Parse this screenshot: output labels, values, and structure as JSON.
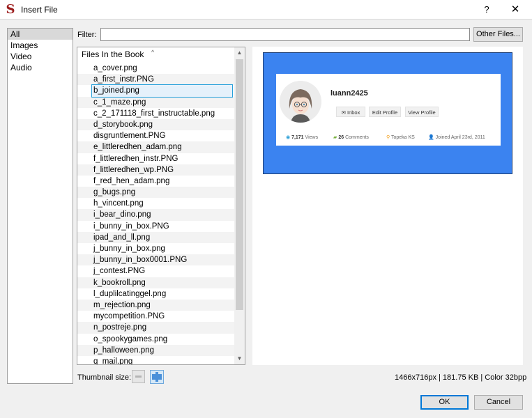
{
  "window": {
    "title": "Insert File",
    "help_label": "?",
    "close_label": "✕",
    "logo_letter": "S",
    "logo_color": "#9b1c1c"
  },
  "categories": {
    "selected_index": 0,
    "items": [
      "All",
      "Images",
      "Video",
      "Audio"
    ]
  },
  "filter": {
    "label": "Filter:",
    "value": "",
    "other_files_label": "Other Files..."
  },
  "file_list": {
    "header": "Files In the Book",
    "sort_indicator": "^",
    "selected_index": 2,
    "files": [
      "a_cover.png",
      "a_first_instr.PNG",
      "b_joined.png",
      "c_1_maze.png",
      "c_2_171118_first_instructable.png",
      "d_storybook.png",
      "disgruntlement.PNG",
      "e_littleredhen_adam.png",
      "f_littleredhen_instr.PNG",
      "f_littleredhen_wp.PNG",
      "f_red_hen_adam.png",
      "g_bugs.png",
      "h_vincent.png",
      "i_bear_dino.png",
      "i_bunny_in_box.PNG",
      "ipad_and_ll.png",
      "j_bunny_in_box.png",
      "j_bunny_in_box0001.PNG",
      "j_contest.PNG",
      "k_bookroll.png",
      "l_duplilcatinggel.png",
      "m_rejection.png",
      "mycompetition.PNG",
      "n_postreje.png",
      "o_spookygames.png",
      "p_halloween.png",
      "q_mail.png"
    ]
  },
  "preview": {
    "background_color": "#3b83f0",
    "profile": {
      "username": "luann2425",
      "buttons": [
        "Inbox",
        "Edit Profile",
        "View Profile"
      ],
      "views_count": "7,171",
      "views_label": "Views",
      "comments_count": "26",
      "comments_label": "Comments",
      "location": "Topeka KS",
      "joined": "Joined April 23rd, 2011"
    }
  },
  "thumbnail": {
    "label": "Thumbnail size:",
    "selected": "large"
  },
  "image_info": "1466x716px | 181.75 KB | Color 32bpp",
  "buttons": {
    "ok_label": "OK",
    "cancel_label": "Cancel"
  }
}
